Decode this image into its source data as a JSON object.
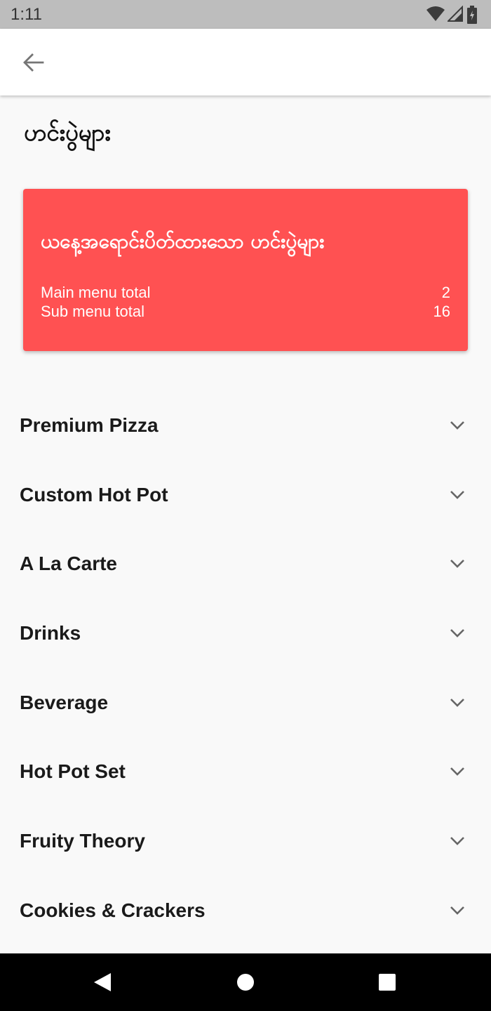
{
  "status_bar": {
    "time": "1:11",
    "icons": [
      "wifi-icon",
      "cellular-signal-icon",
      "battery-icon"
    ]
  },
  "app_bar": {
    "back_icon": "arrow-left-icon"
  },
  "page": {
    "title": "ဟင်းပွဲများ"
  },
  "summary_card": {
    "title": "ယနေ့အရောင်းပိတ်ထားသော ဟင်းပွဲများ",
    "main_menu_label": "Main menu total",
    "main_menu_value": "2",
    "sub_menu_label": "Sub menu total",
    "sub_menu_value": "16",
    "color": "#ff5152"
  },
  "menu_items": [
    {
      "label": "Premium Pizza"
    },
    {
      "label": "Custom Hot Pot"
    },
    {
      "label": "A La Carte"
    },
    {
      "label": "Drinks"
    },
    {
      "label": "Beverage"
    },
    {
      "label": "Hot Pot Set"
    },
    {
      "label": "Fruity Theory"
    },
    {
      "label": "Cookies & Crackers"
    }
  ],
  "nav_bar": {
    "icons": [
      "nav-back-icon",
      "nav-home-icon",
      "nav-recents-icon"
    ]
  }
}
